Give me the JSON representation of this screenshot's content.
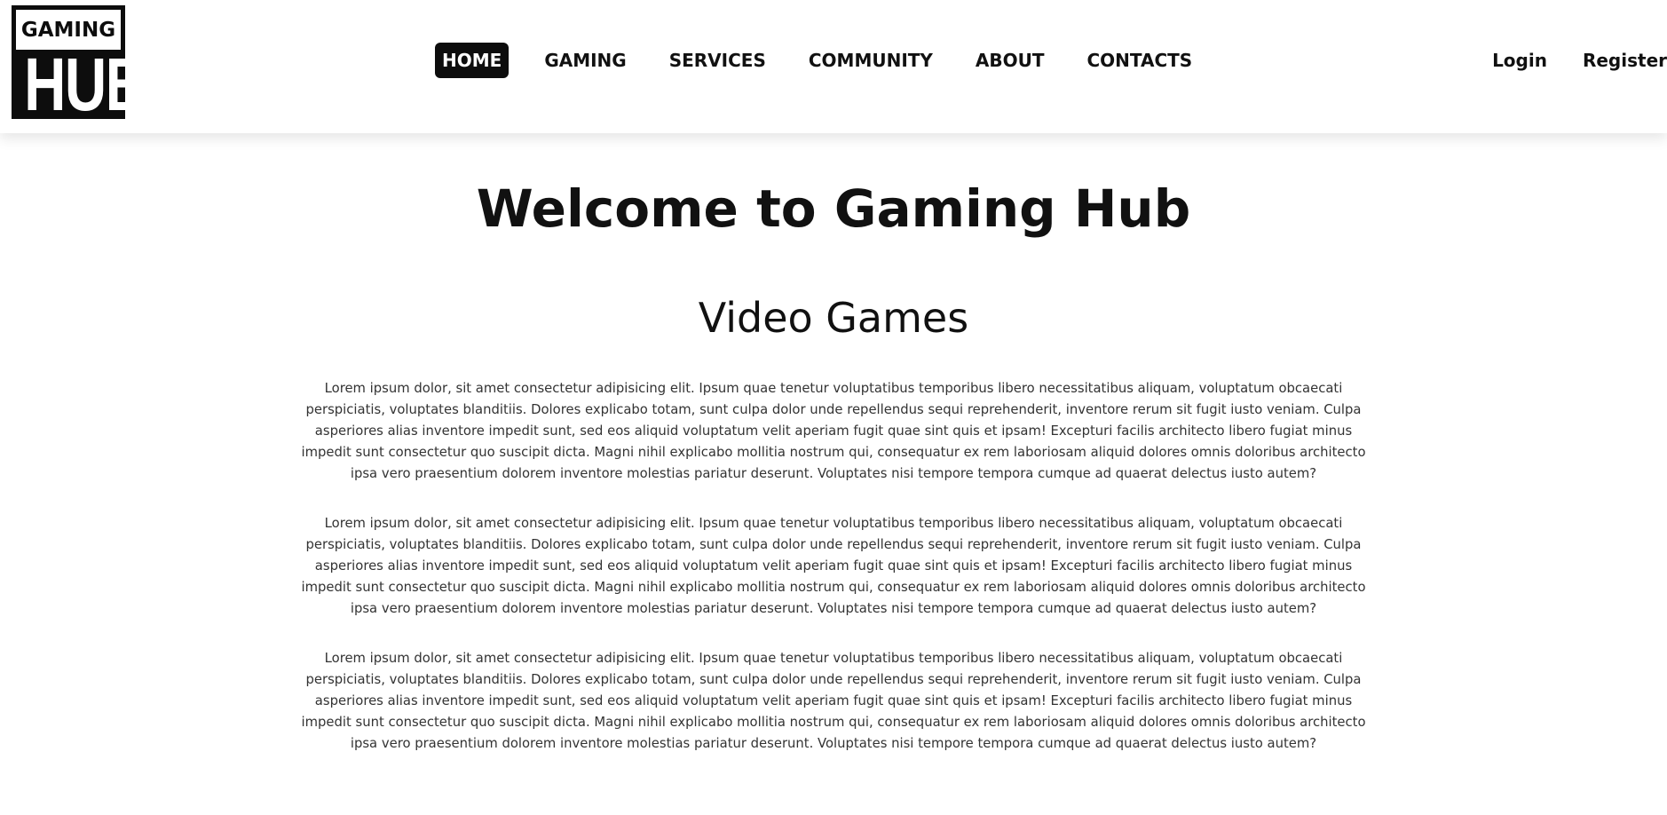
{
  "logo": {
    "top": "GAMING",
    "bottom": "HUB"
  },
  "nav": {
    "items": [
      {
        "label": "HOME",
        "active": true
      },
      {
        "label": "GAMING"
      },
      {
        "label": "SERVICES"
      },
      {
        "label": "COMMUNITY"
      },
      {
        "label": "ABOUT"
      },
      {
        "label": "CONTACTS"
      }
    ]
  },
  "auth": {
    "login": "Login",
    "register": "Register"
  },
  "main": {
    "title": "Welcome to Gaming Hub",
    "section_title": "Video Games",
    "paragraphs": [
      "Lorem ipsum dolor, sit amet consectetur adipisicing elit. Ipsum quae tenetur voluptatibus temporibus libero necessitatibus aliquam, voluptatum obcaecati perspiciatis, voluptates blanditiis. Dolores explicabo totam, sunt culpa dolor unde repellendus sequi reprehenderit, inventore rerum sit fugit iusto veniam. Culpa asperiores alias inventore impedit sunt, sed eos aliquid voluptatum velit aperiam fugit quae sint quis et ipsam! Excepturi facilis architecto libero fugiat minus impedit sunt consectetur quo suscipit dicta. Magni nihil explicabo mollitia nostrum qui, consequatur ex rem laboriosam aliquid dolores omnis doloribus architecto ipsa vero praesentium dolorem inventore molestias pariatur deserunt. Voluptates nisi tempore tempora cumque ad quaerat delectus iusto autem?",
      "Lorem ipsum dolor, sit amet consectetur adipisicing elit. Ipsum quae tenetur voluptatibus temporibus libero necessitatibus aliquam, voluptatum obcaecati perspiciatis, voluptates blanditiis. Dolores explicabo totam, sunt culpa dolor unde repellendus sequi reprehenderit, inventore rerum sit fugit iusto veniam. Culpa asperiores alias inventore impedit sunt, sed eos aliquid voluptatum velit aperiam fugit quae sint quis et ipsam! Excepturi facilis architecto libero fugiat minus impedit sunt consectetur quo suscipit dicta. Magni nihil explicabo mollitia nostrum qui, consequatur ex rem laboriosam aliquid dolores omnis doloribus architecto ipsa vero praesentium dolorem inventore molestias pariatur deserunt. Voluptates nisi tempore tempora cumque ad quaerat delectus iusto autem?",
      "Lorem ipsum dolor, sit amet consectetur adipisicing elit. Ipsum quae tenetur voluptatibus temporibus libero necessitatibus aliquam, voluptatum obcaecati perspiciatis, voluptates blanditiis. Dolores explicabo totam, sunt culpa dolor unde repellendus sequi reprehenderit, inventore rerum sit fugit iusto veniam. Culpa asperiores alias inventore impedit sunt, sed eos aliquid voluptatum velit aperiam fugit quae sint quis et ipsam! Excepturi facilis architecto libero fugiat minus impedit sunt consectetur quo suscipit dicta. Magni nihil explicabo mollitia nostrum qui, consequatur ex rem laboriosam aliquid dolores omnis doloribus architecto ipsa vero praesentium dolorem inventore molestias pariatur deserunt. Voluptates nisi tempore tempora cumque ad quaerat delectus iusto autem?"
    ]
  },
  "colors": {
    "background": "#ffffff",
    "text": "#111111",
    "body_text": "#333333",
    "accent": "#0d0d0d"
  }
}
